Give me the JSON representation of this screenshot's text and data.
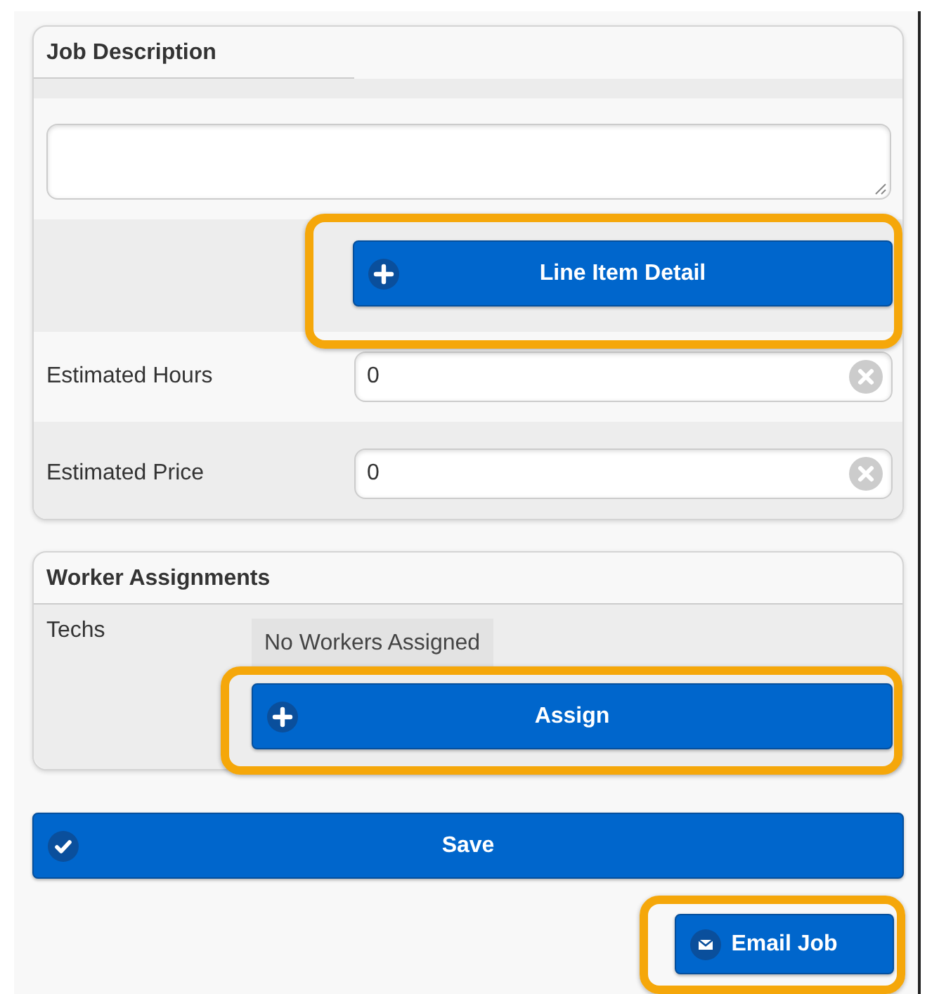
{
  "job_description": {
    "title": "Job Description",
    "line_item_button": {
      "label": "Line Item Detail",
      "highlighted": true
    }
  },
  "fields": [
    {
      "label": "Estimated Hours",
      "value": "0"
    },
    {
      "label": "Estimated Price",
      "value": "0"
    }
  ],
  "worker_assignments": {
    "title": "Worker Assignments",
    "techs_label": "Techs",
    "status": "No Workers Assigned",
    "assign_button": {
      "label": "Assign",
      "highlighted": true
    }
  },
  "save_button": {
    "label": "Save"
  },
  "email_button": {
    "label": "Email Job",
    "highlighted": true
  }
}
